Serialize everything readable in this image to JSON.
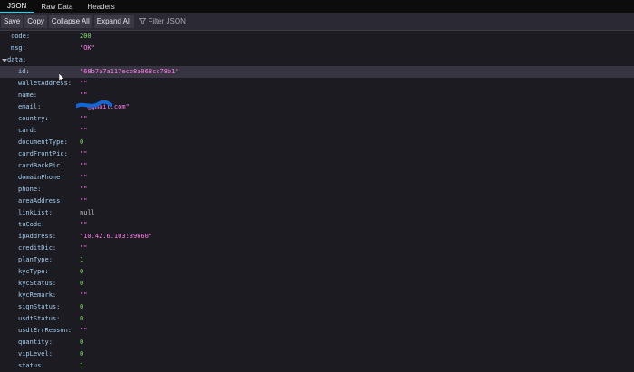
{
  "tabs": [
    "JSON",
    "Raw Data",
    "Headers"
  ],
  "toolbar": {
    "save": "Save",
    "copy": "Copy",
    "collapse_all": "Collapse All",
    "expand_all": "Expand All",
    "filter_placeholder": "Filter JSON",
    "filter_icon": "funnel-icon"
  },
  "rows": [
    {
      "key": "code:",
      "value": "200",
      "type": "num",
      "indent": 1
    },
    {
      "key": "msg:",
      "value": "\"OK\"",
      "type": "str",
      "indent": 1
    },
    {
      "key": "data:",
      "value": "",
      "type": "obj",
      "indent": 0,
      "expanded": true
    },
    {
      "key": "id:",
      "value": "\"68b7a7a117ecb8a068cc78b1\"",
      "type": "str",
      "indent": 2,
      "selected": true
    },
    {
      "key": "walletAddress:",
      "value": "\"\"",
      "type": "str",
      "indent": 2
    },
    {
      "key": "name:",
      "value": "\"\"",
      "type": "str",
      "indent": 2
    },
    {
      "key": "email:",
      "value": "\"        @gmail.com\"",
      "type": "str",
      "indent": 2
    },
    {
      "key": "country:",
      "value": "\"\"",
      "type": "str",
      "indent": 2
    },
    {
      "key": "card:",
      "value": "\"\"",
      "type": "str",
      "indent": 2
    },
    {
      "key": "documentType:",
      "value": "0",
      "type": "num",
      "indent": 2
    },
    {
      "key": "cardFrontPic:",
      "value": "\"\"",
      "type": "str",
      "indent": 2
    },
    {
      "key": "cardBackPic:",
      "value": "\"\"",
      "type": "str",
      "indent": 2
    },
    {
      "key": "domainPhone:",
      "value": "\"\"",
      "type": "str",
      "indent": 2
    },
    {
      "key": "phone:",
      "value": "\"\"",
      "type": "str",
      "indent": 2
    },
    {
      "key": "areaAddress:",
      "value": "\"\"",
      "type": "str",
      "indent": 2
    },
    {
      "key": "linkList:",
      "value": "null",
      "type": "nul",
      "indent": 2
    },
    {
      "key": "tuCode:",
      "value": "\"\"",
      "type": "str",
      "indent": 2
    },
    {
      "key": "ipAddress:",
      "value": "\"10.42.6.103:39660\"",
      "type": "str",
      "indent": 2
    },
    {
      "key": "creditDic:",
      "value": "\"\"",
      "type": "str",
      "indent": 2
    },
    {
      "key": "planType:",
      "value": "1",
      "type": "num",
      "indent": 2
    },
    {
      "key": "kycType:",
      "value": "0",
      "type": "num",
      "indent": 2
    },
    {
      "key": "kycStatus:",
      "value": "0",
      "type": "num",
      "indent": 2
    },
    {
      "key": "kycRemark:",
      "value": "\"\"",
      "type": "str",
      "indent": 2
    },
    {
      "key": "signStatus:",
      "value": "0",
      "type": "num",
      "indent": 2
    },
    {
      "key": "usdtStatus:",
      "value": "0",
      "type": "num",
      "indent": 2
    },
    {
      "key": "usdtErrReason:",
      "value": "\"\"",
      "type": "str",
      "indent": 2
    },
    {
      "key": "quantity:",
      "value": "0",
      "type": "num",
      "indent": 2
    },
    {
      "key": "vipLevel:",
      "value": "0",
      "type": "num",
      "indent": 2
    },
    {
      "key": "status:",
      "value": "1",
      "type": "num",
      "indent": 2
    }
  ]
}
